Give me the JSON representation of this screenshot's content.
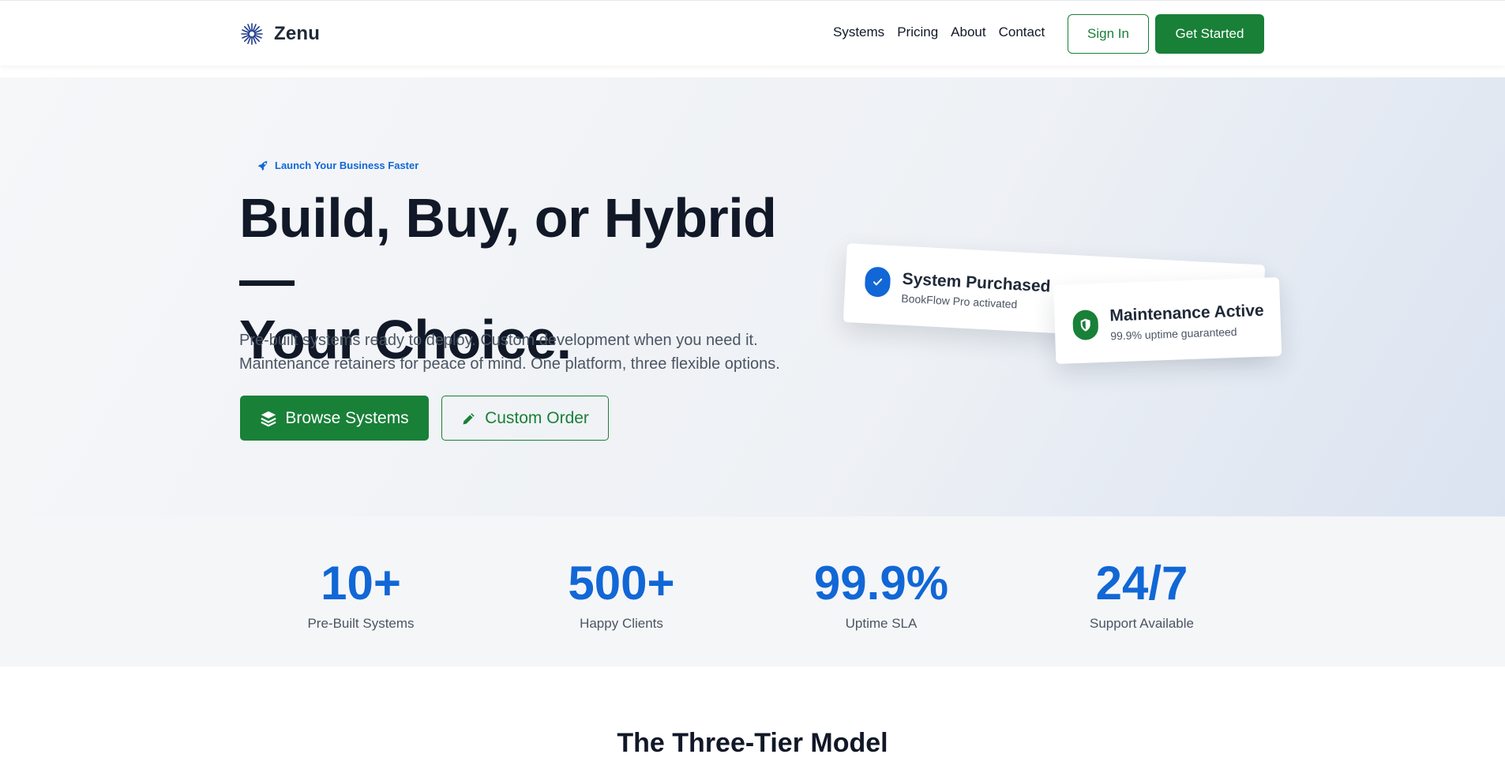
{
  "brand": {
    "name": "Zenu",
    "icon": "zenu-logo-icon"
  },
  "nav": {
    "links": [
      "Systems",
      "Pricing",
      "About",
      "Contact"
    ],
    "signin_label": "Sign In",
    "get_started_label": "Get Started"
  },
  "hero": {
    "badge": "Launch Your Business Faster",
    "badge_icon": "rocket-icon",
    "title_line1": "Build, Buy, or Hybrid —",
    "title_line2": "Your Choice.",
    "subtitle_line1": "Pre-built systems ready to deploy. Custom development when you need it.",
    "subtitle_line2": "Maintenance retainers for peace of mind. One platform, three flexible options.",
    "browse_label": "Browse Systems",
    "browse_icon": "layers-icon",
    "custom_label": "Custom Order",
    "custom_icon": "pencil-icon"
  },
  "cards": {
    "purchased": {
      "title": "System Purchased",
      "subtitle": "BookFlow Pro activated",
      "icon": "check-icon"
    },
    "maintenance": {
      "title": "Maintenance Active",
      "subtitle": "99.9% uptime guaranteed",
      "icon": "shield-icon"
    }
  },
  "stats": [
    {
      "value": "10+",
      "label": "Pre-Built Systems"
    },
    {
      "value": "500+",
      "label": "Happy Clients"
    },
    {
      "value": "99.9%",
      "label": "Uptime SLA"
    },
    {
      "value": "24/7",
      "label": "Support Available"
    }
  ],
  "section": {
    "title": "The Three-Tier Model"
  },
  "colors": {
    "primary_green": "#198038",
    "accent_blue": "#1167d6",
    "text_dark": "#111827"
  }
}
